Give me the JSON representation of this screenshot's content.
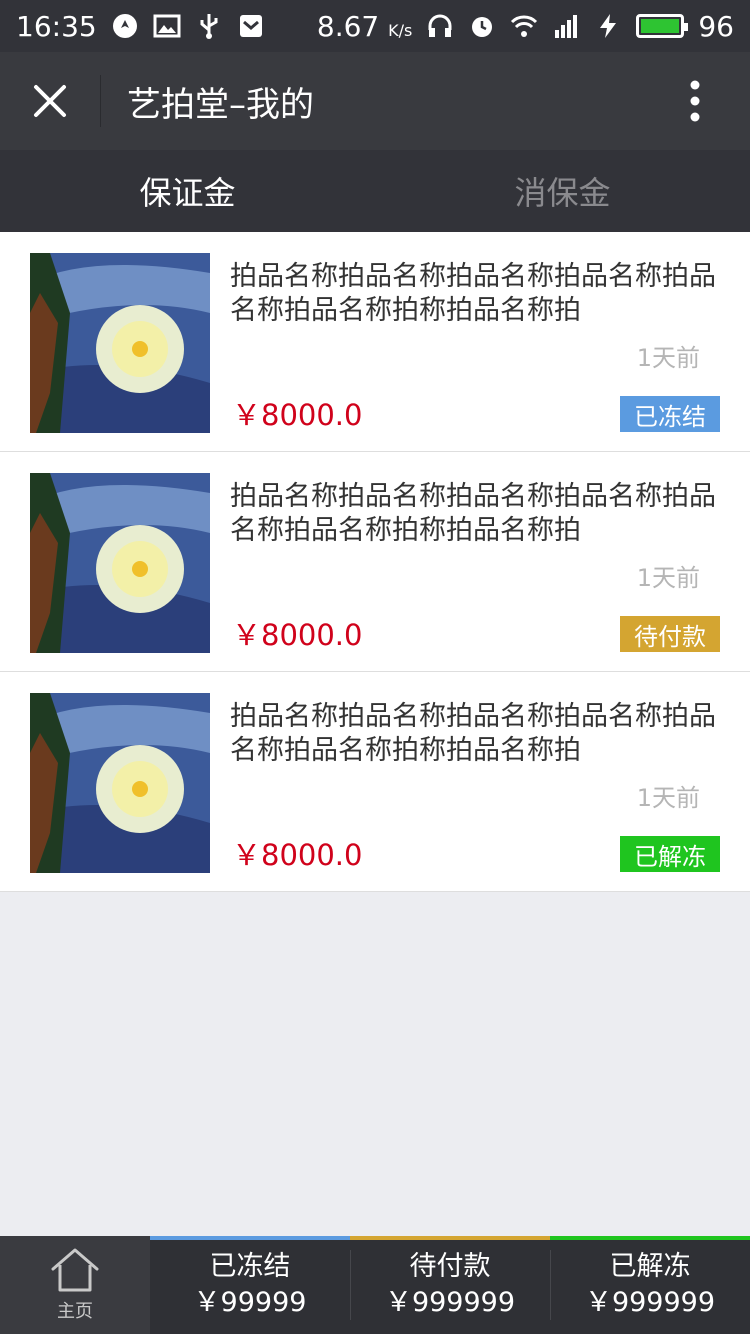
{
  "status_bar": {
    "time": "16:35",
    "speed_value": "8.67",
    "speed_unit": "K/s",
    "battery": "96"
  },
  "nav": {
    "title": "艺拍堂–我的"
  },
  "tabs": [
    {
      "label": "保证金",
      "active": true
    },
    {
      "label": "消保金",
      "active": false
    }
  ],
  "items": [
    {
      "name": "拍品名称拍品名称拍品名称拍品名称拍品名称拍品名称拍称拍品名称拍",
      "time": "1天前",
      "price": "￥8000.0",
      "status": "已冻结",
      "status_color": "#5b9be0"
    },
    {
      "name": "拍品名称拍品名称拍品名称拍品名称拍品名称拍品名称拍称拍品名称拍",
      "time": "1天前",
      "price": "￥8000.0",
      "status": "待付款",
      "status_color": "#d4a531"
    },
    {
      "name": "拍品名称拍品名称拍品名称拍品名称拍品名称拍品名称拍称拍品名称拍",
      "time": "1天前",
      "price": "￥8000.0",
      "status": "已解冻",
      "status_color": "#1fc51f"
    }
  ],
  "bottom_bar": {
    "home_label": "主页",
    "summaries": [
      {
        "label": "已冻结",
        "amount": "￥99999",
        "color": "#5b9be0"
      },
      {
        "label": "待付款",
        "amount": "￥999999",
        "color": "#d4a531"
      },
      {
        "label": "已解冻",
        "amount": "￥999999",
        "color": "#1fc51f"
      }
    ]
  }
}
